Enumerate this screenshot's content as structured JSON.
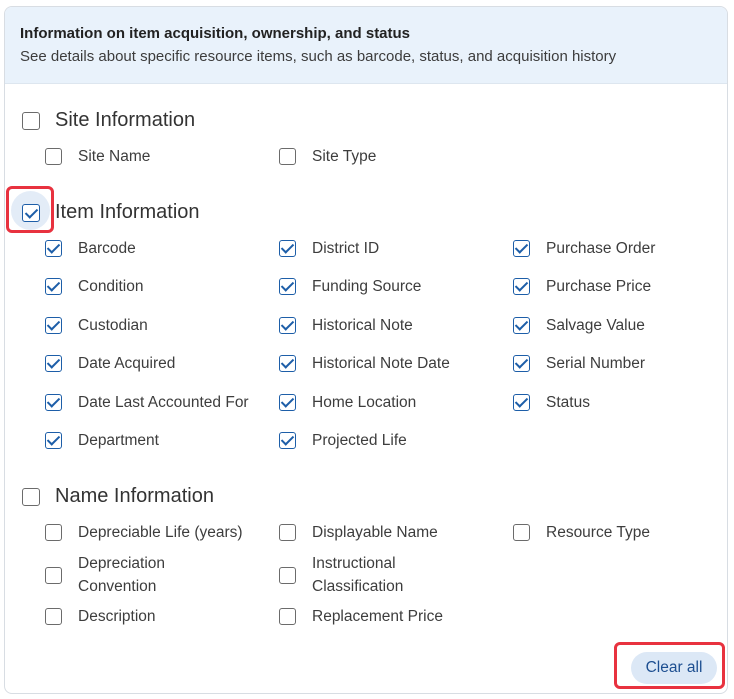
{
  "header": {
    "title": "Information on item acquisition, ownership, and status",
    "subtitle": "See details about specific resource items, such as barcode, status, and acquisition history"
  },
  "sections": {
    "site": {
      "label": "Site Information",
      "checked": false,
      "options": [
        {
          "label": "Site Name",
          "checked": false
        },
        {
          "label": "Site Type",
          "checked": false
        }
      ]
    },
    "item": {
      "label": "Item Information",
      "checked": true,
      "options": [
        {
          "label": "Barcode",
          "checked": true
        },
        {
          "label": "District ID",
          "checked": true
        },
        {
          "label": "Purchase Order",
          "checked": true
        },
        {
          "label": "Condition",
          "checked": true
        },
        {
          "label": "Funding Source",
          "checked": true
        },
        {
          "label": "Purchase Price",
          "checked": true
        },
        {
          "label": "Custodian",
          "checked": true
        },
        {
          "label": "Historical Note",
          "checked": true
        },
        {
          "label": "Salvage Value",
          "checked": true
        },
        {
          "label": "Date Acquired",
          "checked": true
        },
        {
          "label": "Historical Note Date",
          "checked": true
        },
        {
          "label": "Serial Number",
          "checked": true
        },
        {
          "label": "Date Last Accounted For",
          "checked": true
        },
        {
          "label": "Home Location",
          "checked": true
        },
        {
          "label": "Status",
          "checked": true
        },
        {
          "label": "Department",
          "checked": true
        },
        {
          "label": "Projected Life",
          "checked": true
        }
      ]
    },
    "name": {
      "label": "Name Information",
      "checked": false,
      "options": [
        {
          "label": "Depreciable Life (years)",
          "checked": false
        },
        {
          "label": "Displayable Name",
          "checked": false
        },
        {
          "label": "Resource Type",
          "checked": false
        },
        {
          "label": "Depreciation Convention",
          "checked": false
        },
        {
          "label": "Instructional Classification",
          "checked": false
        },
        {
          "label": "Description",
          "checked": false
        },
        {
          "label": "Replacement Price",
          "checked": false
        }
      ]
    }
  },
  "footer": {
    "clear_all_label": "Clear all"
  },
  "colors": {
    "accent": "#1d5ea8",
    "highlight": "#e8323f",
    "header_bg": "#e9f2fb",
    "button_bg": "#dce8f6"
  }
}
